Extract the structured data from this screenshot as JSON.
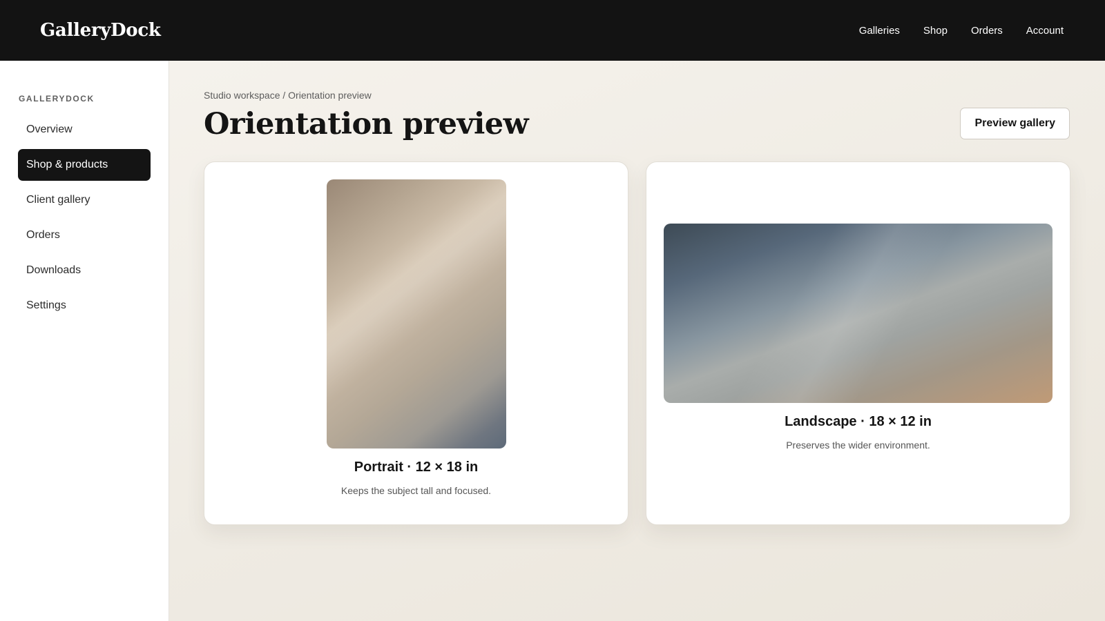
{
  "brand": "GalleryDock",
  "topnav": {
    "items": [
      {
        "label": "Galleries"
      },
      {
        "label": "Shop"
      },
      {
        "label": "Orders"
      },
      {
        "label": "Account"
      }
    ]
  },
  "sidebar": {
    "heading": "GALLERYDOCK",
    "items": [
      {
        "label": "Overview",
        "active": false
      },
      {
        "label": "Shop & products",
        "active": true
      },
      {
        "label": "Client gallery",
        "active": false
      },
      {
        "label": "Orders",
        "active": false
      },
      {
        "label": "Downloads",
        "active": false
      },
      {
        "label": "Settings",
        "active": false
      }
    ]
  },
  "main": {
    "breadcrumb": "Studio workspace / Orientation preview",
    "title": "Orientation preview",
    "preview_button": "Preview gallery",
    "cards": [
      {
        "orientation": "portrait",
        "title": "Portrait · 12 × 18 in",
        "description": "Keeps the subject tall and focused."
      },
      {
        "orientation": "landscape",
        "title": "Landscape · 18 × 12 in",
        "description": "Preserves the wider environment."
      }
    ]
  },
  "colors": {
    "topbar": "#131313",
    "active_item": "#141414",
    "main_background": "#f2eee7",
    "card_background": "#ffffff"
  }
}
